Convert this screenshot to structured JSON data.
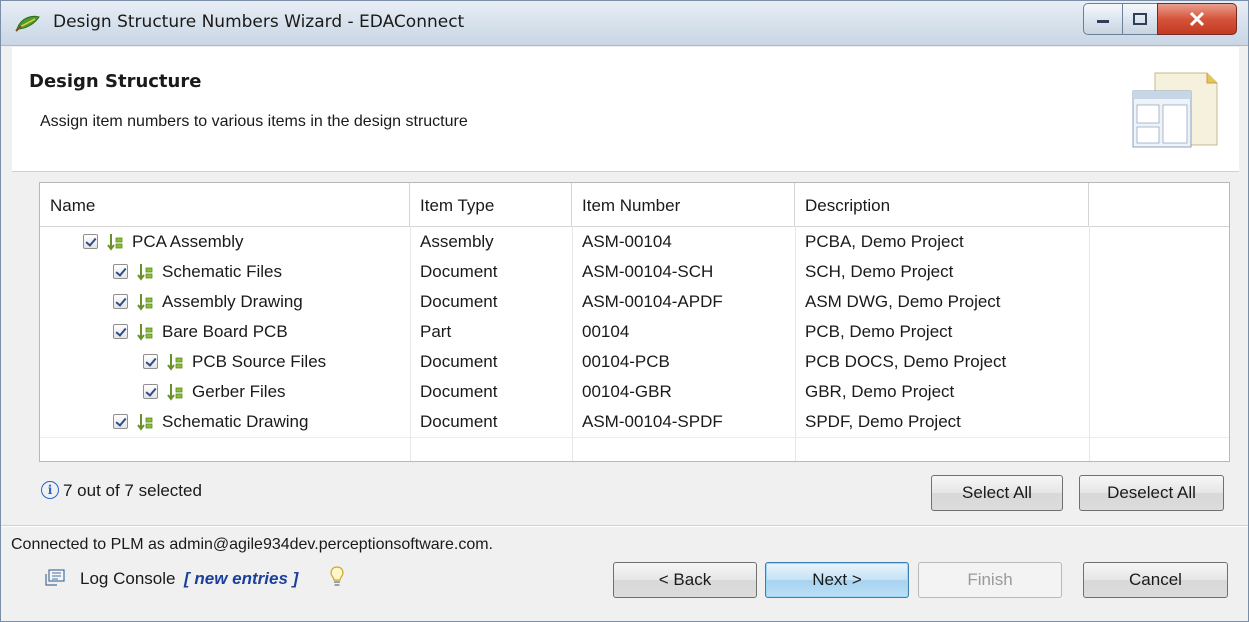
{
  "window": {
    "title": "Design Structure Numbers Wizard - EDAConnect",
    "icon": "app-leaf-icon"
  },
  "header": {
    "title": "Design Structure",
    "subtitle": "Assign item numbers to various items in the design structure",
    "icon": "wizard-banner-icon"
  },
  "table": {
    "columns": [
      "Name",
      "Item Type",
      "Item Number",
      "Description"
    ],
    "rows": [
      {
        "name": "PCA Assembly",
        "type": "Assembly",
        "number": "ASM-00104",
        "description": "PCBA, Demo Project",
        "checked": true,
        "level": 0
      },
      {
        "name": "Schematic Files",
        "type": "Document",
        "number": "ASM-00104-SCH",
        "description": "SCH, Demo Project",
        "checked": true,
        "level": 1
      },
      {
        "name": "Assembly Drawing",
        "type": "Document",
        "number": "ASM-00104-APDF",
        "description": "ASM DWG, Demo Project",
        "checked": true,
        "level": 1
      },
      {
        "name": "Bare Board PCB",
        "type": "Part",
        "number": "00104",
        "description": "PCB, Demo Project",
        "checked": true,
        "level": 1
      },
      {
        "name": "PCB Source Files",
        "type": "Document",
        "number": "00104-PCB",
        "description": "PCB DOCS, Demo Project",
        "checked": true,
        "level": 2
      },
      {
        "name": "Gerber Files",
        "type": "Document",
        "number": "00104-GBR",
        "description": "GBR, Demo Project",
        "checked": true,
        "level": 2
      },
      {
        "name": "Schematic Drawing",
        "type": "Document",
        "number": "ASM-00104-SPDF",
        "description": "SPDF, Demo Project",
        "checked": true,
        "level": 1
      }
    ]
  },
  "status": {
    "text": "7 out of 7 selected",
    "select_all": "Select All",
    "deselect_all": "Deselect All"
  },
  "footer": {
    "connected": "Connected to PLM as admin@agile934dev.perceptionsoftware.com.",
    "log_console": "Log Console",
    "log_new_entries": "[ new entries ]"
  },
  "nav": {
    "back": "< Back",
    "next": "Next >",
    "finish": "Finish",
    "cancel": "Cancel"
  },
  "colors": {
    "accent": "#3c7fb1",
    "link": "#1c3f9c",
    "close": "#c13a21"
  }
}
